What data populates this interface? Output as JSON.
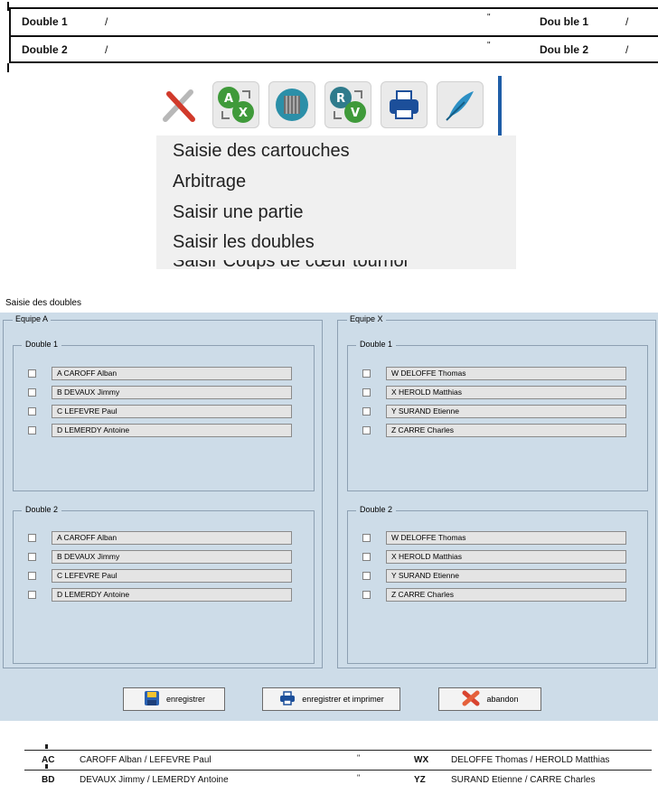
{
  "top_sheet": {
    "rows": [
      {
        "left": "Double 1",
        "sep1": "/",
        "mid": "\"",
        "right": "Dou ble 1",
        "sep2": "/"
      },
      {
        "left": "Double 2",
        "sep1": "/",
        "mid": "\"",
        "right": "Dou ble 2",
        "sep2": "/"
      }
    ]
  },
  "toolbar": {
    "icons": [
      "tools-icon",
      "swap-a-x-icon",
      "book-icon",
      "swap-r-v-icon",
      "printer-icon",
      "feather-icon"
    ]
  },
  "menu": {
    "items": [
      "Saisie des cartouches",
      "Arbitrage",
      "Saisir une partie",
      "Saisir les doubles",
      "Saisir Coups de cœur tournoi"
    ]
  },
  "dialog": {
    "title": "Saisie des doubles",
    "team_a": {
      "label": "Equipe A",
      "double1": {
        "label": "Double 1",
        "players": [
          "A  CAROFF  Alban",
          "B  DEVAUX  Jimmy",
          "C  LEFEVRE  Paul",
          "D  LEMERDY  Antoine"
        ]
      },
      "double2": {
        "label": "Double 2",
        "players": [
          "A  CAROFF  Alban",
          "B  DEVAUX  Jimmy",
          "C  LEFEVRE  Paul",
          "D  LEMERDY  Antoine"
        ]
      }
    },
    "team_x": {
      "label": "Equipe X",
      "double1": {
        "label": "Double 1",
        "players": [
          "W  DELOFFE  Thomas",
          "X  HEROLD  Matthias",
          "Y  SURAND  Etienne",
          "Z  CARRE  Charles"
        ]
      },
      "double2": {
        "label": "Double 2",
        "players": [
          "W  DELOFFE  Thomas",
          "X  HEROLD  Matthias",
          "Y  SURAND  Etienne",
          "Z  CARRE  Charles"
        ]
      }
    },
    "buttons": {
      "save": "enregistrer",
      "save_print": "enregistrer et imprimer",
      "cancel": "abandon"
    }
  },
  "bottom_sheet": {
    "rows": [
      {
        "code": "AC",
        "names": "CAROFF Alban / LEFEVRE Paul",
        "mid": "\"",
        "code2": "WX",
        "names2": "DELOFFE Thomas / HEROLD Matthias"
      },
      {
        "code": "BD",
        "names": "DEVAUX Jimmy / LEMERDY Antoine",
        "mid": "\"",
        "code2": "YZ",
        "names2": "SURAND Etienne / CARRE Charles"
      }
    ]
  }
}
